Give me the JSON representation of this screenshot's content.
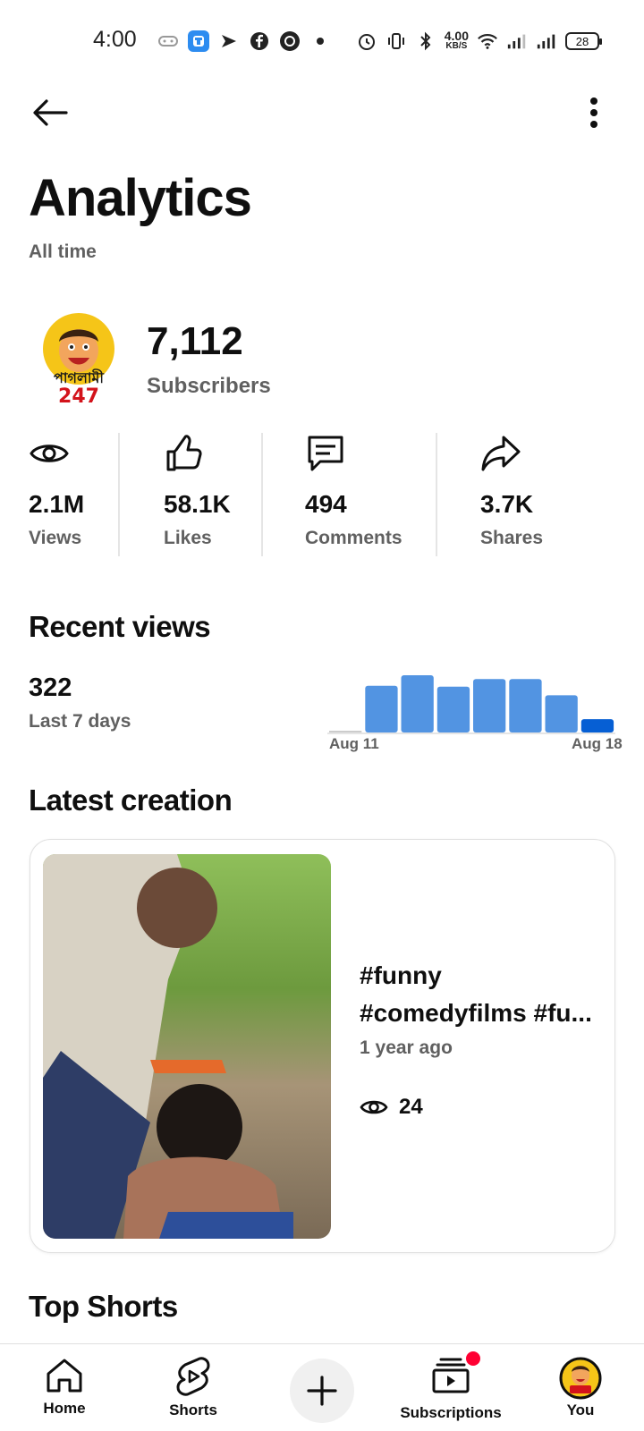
{
  "status_bar": {
    "time": "4:00",
    "speed_value": "4.00",
    "speed_unit": "KB/S",
    "battery": "28"
  },
  "header": {
    "title": "Analytics",
    "subtitle": "All time"
  },
  "channel": {
    "subscriber_count": "7,112",
    "subscriber_label": "Subscribers",
    "avatar_text_1": "পাগলামী",
    "avatar_text_2": "247"
  },
  "stats": [
    {
      "value": "2.1M",
      "label": "Views",
      "icon": "eye-icon"
    },
    {
      "value": "58.1K",
      "label": "Likes",
      "icon": "thumbs-up-icon"
    },
    {
      "value": "494",
      "label": "Comments",
      "icon": "comment-icon"
    },
    {
      "value": "3.7K",
      "label": "Shares",
      "icon": "share-icon"
    }
  ],
  "recent_views": {
    "title": "Recent views",
    "count": "322",
    "period": "Last 7 days",
    "axis_start": "Aug 11",
    "axis_end": "Aug 18"
  },
  "chart_data": {
    "type": "bar",
    "categories": [
      "Aug 11",
      "",
      "",
      "",
      "",
      "",
      "",
      "Aug 18"
    ],
    "values": [
      1,
      49,
      60,
      48,
      56,
      56,
      39,
      14
    ],
    "highlight_index": 7,
    "colors": {
      "bar": "#5294e2",
      "highlight": "#065fd4",
      "baseline": "#cccccc"
    }
  },
  "latest_creation": {
    "title": "Latest creation",
    "video_title_line1": "#funny",
    "video_title_line2": "#comedyfilms #fu...",
    "age": "1 year ago",
    "views": "24"
  },
  "top_shorts": {
    "title": "Top Shorts"
  },
  "bottom_nav": {
    "home": "Home",
    "shorts": "Shorts",
    "subscriptions": "Subscriptions",
    "you": "You"
  }
}
